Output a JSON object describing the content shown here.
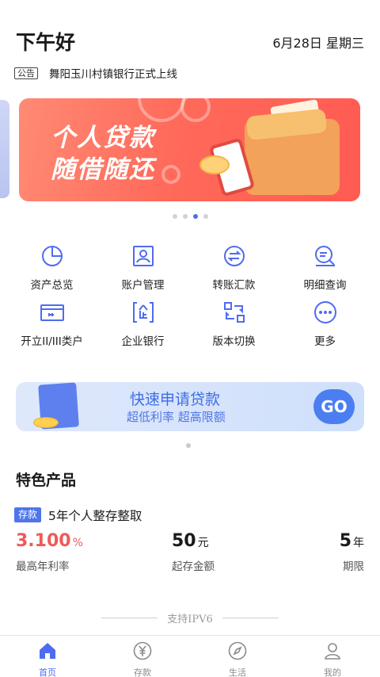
{
  "header": {
    "greeting": "下午好",
    "date": "6月28日  星期三",
    "notice_tag": "公告",
    "notice_text": "舞阳玉川村镇银行正式上线"
  },
  "banner": {
    "line1": "个人贷款",
    "line2": "随借随还",
    "page_count": 4,
    "active_page": 3
  },
  "grid": {
    "items": [
      {
        "label": "资产总览",
        "icon": "pie-chart-icon"
      },
      {
        "label": "账户管理",
        "icon": "account-card-icon"
      },
      {
        "label": "转账汇款",
        "icon": "transfer-icon"
      },
      {
        "label": "明细查询",
        "icon": "detail-search-icon"
      },
      {
        "label": "开立II/III类户",
        "icon": "bank-card-icon"
      },
      {
        "label": "企业银行",
        "icon": "enterprise-icon"
      },
      {
        "label": "版本切换",
        "icon": "switch-icon"
      },
      {
        "label": "更多",
        "icon": "more-icon"
      }
    ]
  },
  "loan_banner": {
    "title": "快速申请贷款",
    "subtitle": "超低利率 超高限额",
    "go_label": "GO"
  },
  "featured": {
    "title": "特色产品",
    "product_tag": "存款",
    "product_name": "5年个人整存整取",
    "rate_value": "3.100",
    "rate_unit": "%",
    "rate_label": "最高年利率",
    "min_value": "50",
    "min_unit": "元",
    "min_label": "起存金额",
    "term_value": "5",
    "term_unit": "年",
    "term_label": "期限"
  },
  "footer_note": "支持IPV6",
  "tabbar": {
    "items": [
      {
        "label": "首页",
        "icon": "home-icon",
        "active": true
      },
      {
        "label": "存款",
        "icon": "deposit-icon",
        "active": false
      },
      {
        "label": "生活",
        "icon": "compass-icon",
        "active": false
      },
      {
        "label": "我的",
        "icon": "user-icon",
        "active": false
      }
    ]
  },
  "colors": {
    "accent": "#4e6cf0",
    "rate_red": "#ee5a5a",
    "banner_red": "#ff6a5a"
  }
}
